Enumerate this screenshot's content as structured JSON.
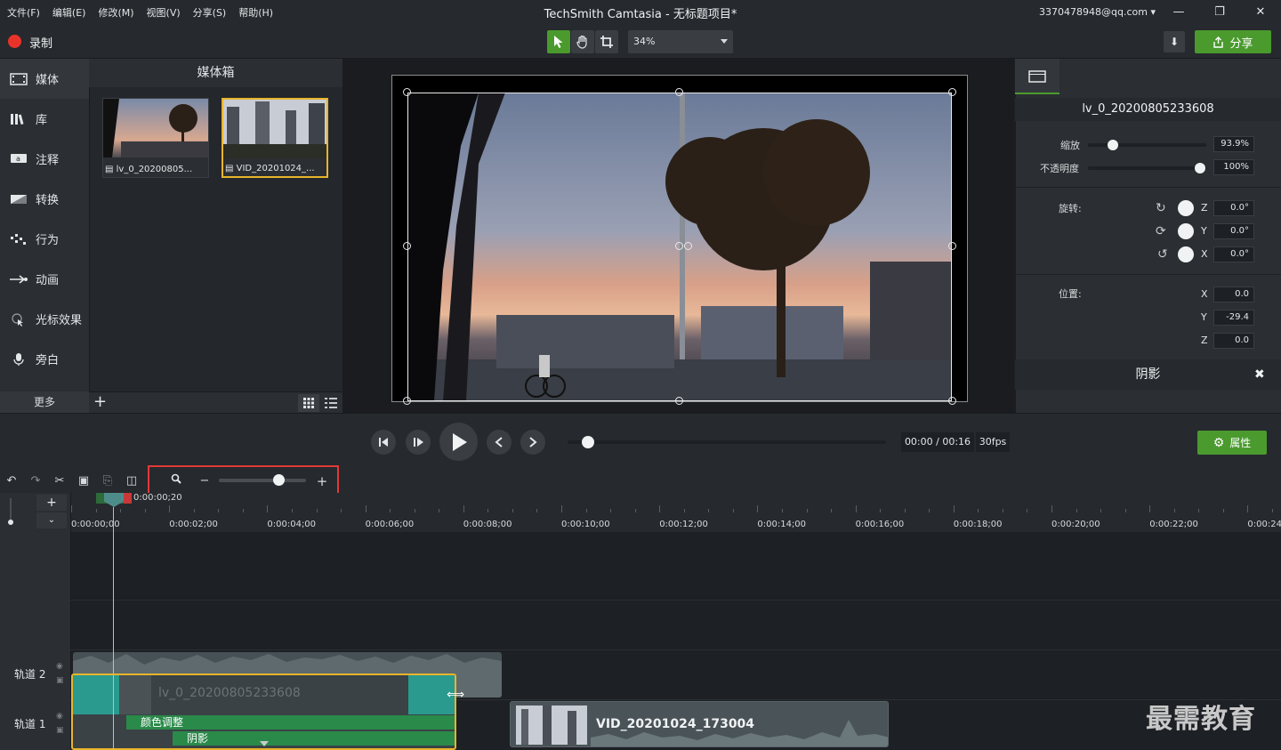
{
  "menu": [
    "文件(F)",
    "编辑(E)",
    "修改(M)",
    "视图(V)",
    "分享(S)",
    "帮助(H)"
  ],
  "window_title": "TechSmith Camtasia - 无标题项目*",
  "account": "3370478948@qq.com",
  "toolbar": {
    "record_label": "录制",
    "zoom_value": "34%",
    "share_label": "分享"
  },
  "left_nav": {
    "items": [
      "媒体",
      "库",
      "注释",
      "转换",
      "行为",
      "动画",
      "光标效果",
      "旁白"
    ],
    "more_label": "更多"
  },
  "media_bin": {
    "title": "媒体箱",
    "items": [
      {
        "label": "lv_0_20200805..."
      },
      {
        "label": "VID_20201024_..."
      }
    ]
  },
  "properties": {
    "clip_name": "lv_0_20200805233608",
    "scale_label": "缩放",
    "scale_value": "93.9%",
    "opacity_label": "不透明度",
    "opacity_value": "100%",
    "rotation_label": "旋转:",
    "rotation": [
      {
        "axis": "Z",
        "value": "0.0°"
      },
      {
        "axis": "Y",
        "value": "0.0°"
      },
      {
        "axis": "X",
        "value": "0.0°"
      }
    ],
    "position_label": "位置:",
    "position": [
      {
        "axis": "X",
        "value": "0.0"
      },
      {
        "axis": "Y",
        "value": "-29.4"
      },
      {
        "axis": "Z",
        "value": "0.0"
      }
    ],
    "shadow_label": "阴影"
  },
  "playback": {
    "time": "00:00 / 00:16",
    "fps": "30fps",
    "properties_label": "属性"
  },
  "timeline": {
    "playhead_time": "0:00:00;20",
    "ticks": [
      "0:00:00;00",
      "0:00:02;00",
      "0:00:04;00",
      "0:00:06;00",
      "0:00:08;00",
      "0:00:10;00",
      "0:00:12;00",
      "0:00:14;00",
      "0:00:16;00",
      "0:00:18;00",
      "0:00:20;00",
      "0:00:22;00",
      "0:00:24"
    ],
    "tracks": [
      "轨道 2",
      "轨道 1"
    ],
    "clips": {
      "track1_clip1_name": "lv_0_20200805233608",
      "effect_color": "颜色调整",
      "effect_shadow": "阴影",
      "track1_clip2_name": "VID_20201024_173004"
    }
  },
  "watermark": "最需教育",
  "colors": {
    "accent_green": "#4a9a2e",
    "record_red": "#e8332b",
    "selection_yellow": "#e8b52b",
    "highlight_red": "#e03a3a"
  }
}
